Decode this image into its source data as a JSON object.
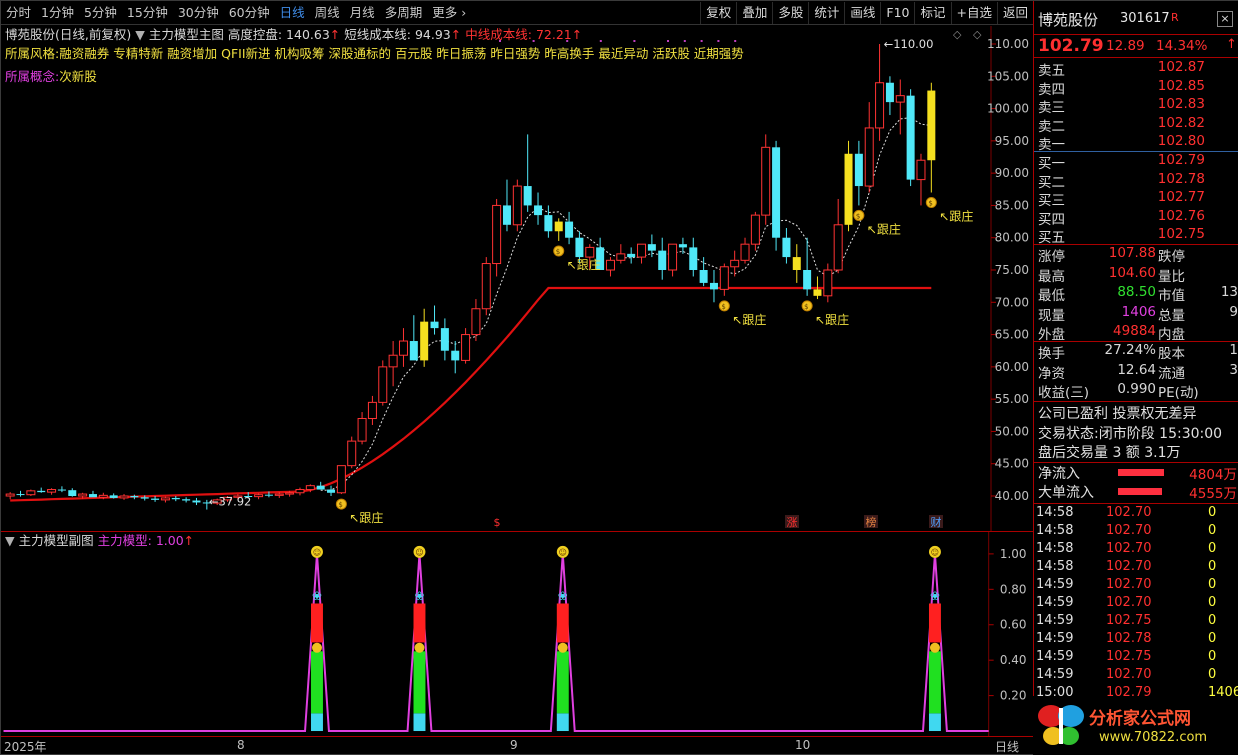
{
  "toolbar": {
    "periods": [
      "分时",
      "1分钟",
      "5分钟",
      "15分钟",
      "30分钟",
      "60分钟",
      "日线",
      "周线",
      "月线",
      "多周期",
      "更多"
    ],
    "active_period": "日线",
    "buttons": [
      "复权",
      "叠加",
      "多股",
      "统计",
      "画线",
      "F10",
      "标记",
      "+自选",
      "返回"
    ]
  },
  "header": {
    "stock_name": "博苑股份",
    "mode": "(日线,前复权)",
    "indicator": "主力模型主图",
    "height_label": "高度控盘:",
    "height_value": "140.63",
    "short_label": "短线成本线:",
    "short_value": "94.93",
    "mid_label": "中线成本线:",
    "mid_value": "72.21"
  },
  "tags": {
    "style_label": "所属风格:",
    "style_value": "融资融券 专精特新 融资增加 QFII新进 机构吸筹 深股通标的 百元股 昨日振荡 昨日强势 昨高换手 最近异动 活跃股 近期强势",
    "concept_label": "所属概念:",
    "concept_value": "次新股"
  },
  "chart_data": {
    "type": "candlestick",
    "y_ticks": [
      "110.00",
      "105.00",
      "100.00",
      "95.00",
      "90.00",
      "85.00",
      "80.00",
      "75.00",
      "70.00",
      "65.00",
      "60.00",
      "55.00",
      "50.00",
      "45.00",
      "40.00"
    ],
    "ylim": [
      37,
      112
    ],
    "candles": [
      [
        40.0,
        40.6,
        39.5,
        40.3
      ],
      [
        40.3,
        40.8,
        39.9,
        40.2
      ],
      [
        40.2,
        41.0,
        40.0,
        40.8
      ],
      [
        40.8,
        41.3,
        40.5,
        40.6
      ],
      [
        40.6,
        41.2,
        40.2,
        41.0
      ],
      [
        41.0,
        41.5,
        40.6,
        40.9
      ],
      [
        40.9,
        41.2,
        39.9,
        40.0
      ],
      [
        40.0,
        40.5,
        39.6,
        40.3
      ],
      [
        40.3,
        40.8,
        39.9,
        39.8
      ],
      [
        39.8,
        40.5,
        39.5,
        40.1
      ],
      [
        40.1,
        40.4,
        39.6,
        39.7
      ],
      [
        39.7,
        40.3,
        39.4,
        40.0
      ],
      [
        40.0,
        40.2,
        39.5,
        39.8
      ],
      [
        39.8,
        40.1,
        39.3,
        39.6
      ],
      [
        39.6,
        40.0,
        39.1,
        39.4
      ],
      [
        39.4,
        39.9,
        39.0,
        39.7
      ],
      [
        39.7,
        40.0,
        39.2,
        39.5
      ],
      [
        39.5,
        39.8,
        39.0,
        39.3
      ],
      [
        39.3,
        39.7,
        38.6,
        39.0
      ],
      [
        39.0,
        39.4,
        37.9,
        38.9
      ],
      [
        38.9,
        39.6,
        38.6,
        39.4
      ],
      [
        39.4,
        40.0,
        39.1,
        39.8
      ],
      [
        39.8,
        40.3,
        39.4,
        40.0
      ],
      [
        40.0,
        40.6,
        39.6,
        39.9
      ],
      [
        39.9,
        40.4,
        39.5,
        40.2
      ],
      [
        40.2,
        40.7,
        39.8,
        40.1
      ],
      [
        40.1,
        40.6,
        39.7,
        40.3
      ],
      [
        40.3,
        40.8,
        39.9,
        40.5
      ],
      [
        40.5,
        41.3,
        40.1,
        41.0
      ],
      [
        41.0,
        41.8,
        40.6,
        41.6
      ],
      [
        41.6,
        42.2,
        41.0,
        41.0
      ],
      [
        41.0,
        41.6,
        40.0,
        40.5
      ],
      [
        40.5,
        44.7,
        40.3,
        44.7
      ],
      [
        44.7,
        49.2,
        44.3,
        48.5
      ],
      [
        48.5,
        53.0,
        48.0,
        52.0
      ],
      [
        52.0,
        55.5,
        51.0,
        54.5
      ],
      [
        54.5,
        61.0,
        54.0,
        60.0
      ],
      [
        60.0,
        64.0,
        57.0,
        61.8
      ],
      [
        61.8,
        66.0,
        60.0,
        64.0
      ],
      [
        64.0,
        68.0,
        62.0,
        61.0
      ],
      [
        61.0,
        69.0,
        60.0,
        67.0
      ],
      [
        67.0,
        69.5,
        65.0,
        66.0
      ],
      [
        66.0,
        67.5,
        61.0,
        62.5
      ],
      [
        62.5,
        64.0,
        59.0,
        61.0
      ],
      [
        61.0,
        66.0,
        60.5,
        65.0
      ],
      [
        65.0,
        70.5,
        64.0,
        69.0
      ],
      [
        69.0,
        77.0,
        68.0,
        76.0
      ],
      [
        76.0,
        86.0,
        74.0,
        85.0
      ],
      [
        85.0,
        89.0,
        81.0,
        82.0
      ],
      [
        82.0,
        89.0,
        81.0,
        88.0
      ],
      [
        88.0,
        96.0,
        84.0,
        85.0
      ],
      [
        85.0,
        87.0,
        82.0,
        83.5
      ],
      [
        83.5,
        85.0,
        80.0,
        81.0
      ],
      [
        81.0,
        83.0,
        79.5,
        82.5
      ],
      [
        82.5,
        84.0,
        79.0,
        80.0
      ],
      [
        80.0,
        81.0,
        76.0,
        77.0
      ],
      [
        77.0,
        79.0,
        75.0,
        78.5
      ],
      [
        78.5,
        80.0,
        75.0,
        75.0
      ],
      [
        75.0,
        77.0,
        74.0,
        76.5
      ],
      [
        76.5,
        79.0,
        76.0,
        77.5
      ],
      [
        77.5,
        78.5,
        76.0,
        77.0
      ],
      [
        77.0,
        78.5,
        76.0,
        79.0
      ],
      [
        79.0,
        80.5,
        77.0,
        78.0
      ],
      [
        78.0,
        80.0,
        73.5,
        75.0
      ],
      [
        75.0,
        76.0,
        74.0,
        79.0
      ],
      [
        79.0,
        80.0,
        77.5,
        78.5
      ],
      [
        78.5,
        80.0,
        74.0,
        75.0
      ],
      [
        75.0,
        77.0,
        72.5,
        73.0
      ],
      [
        73.0,
        75.0,
        70.0,
        72.0
      ],
      [
        72.0,
        76.0,
        71.0,
        75.5
      ],
      [
        75.5,
        78.0,
        74.0,
        76.5
      ],
      [
        76.5,
        80.0,
        76.0,
        79.0
      ],
      [
        79.0,
        84.0,
        78.0,
        83.5
      ],
      [
        83.5,
        96.0,
        82.0,
        94.0
      ],
      [
        94.0,
        95.0,
        78.0,
        80.0
      ],
      [
        80.0,
        81.5,
        76.0,
        77.0
      ],
      [
        77.0,
        79.0,
        73.0,
        75.0
      ],
      [
        75.0,
        80.0,
        71.0,
        72.0
      ],
      [
        72.0,
        74.0,
        70.5,
        71.0
      ],
      [
        71.0,
        76.0,
        70.0,
        75.0
      ],
      [
        75.0,
        86.0,
        74.5,
        82.0
      ],
      [
        82.0,
        95.0,
        81.0,
        93.0
      ],
      [
        93.0,
        95.0,
        85.0,
        88.0
      ],
      [
        88.0,
        101.0,
        87.0,
        97.0
      ],
      [
        97.0,
        110.0,
        95.0,
        104.0
      ],
      [
        104.0,
        105.0,
        99.0,
        101.0
      ],
      [
        101.0,
        104.5,
        96.0,
        102.0
      ],
      [
        102.0,
        103.0,
        88.0,
        89.0
      ],
      [
        89.0,
        93.0,
        85.0,
        92.0
      ],
      [
        92.0,
        104.0,
        87.0,
        102.79
      ]
    ],
    "markers": {
      "high_label": "110.00",
      "low_label": "37.92",
      "follow_label": "跟庄",
      "event_tags": [
        "$",
        "涨",
        "榜",
        "财"
      ]
    }
  },
  "sub": {
    "title": "主力模型副图",
    "label": "主力模型:",
    "value": "1.00",
    "y_ticks": [
      "1.00",
      "0.80",
      "0.60",
      "0.40",
      "0.20"
    ]
  },
  "xaxis": {
    "labels": [
      "2025年",
      "8",
      "9",
      "10"
    ],
    "right_label": "日线"
  },
  "quote": {
    "name": "博苑股份",
    "code": "301617",
    "flag": "R",
    "price": "102.79",
    "change": "12.89",
    "pct": "14.34%",
    "asks": [
      {
        "label": "卖五",
        "price": "102.87"
      },
      {
        "label": "卖四",
        "price": "102.85"
      },
      {
        "label": "卖三",
        "price": "102.83"
      },
      {
        "label": "卖二",
        "price": "102.82"
      },
      {
        "label": "卖一",
        "price": "102.80"
      }
    ],
    "bids": [
      {
        "label": "买一",
        "price": "102.79"
      },
      {
        "label": "买二",
        "price": "102.78"
      },
      {
        "label": "买三",
        "price": "102.77"
      },
      {
        "label": "买四",
        "price": "102.76"
      },
      {
        "label": "买五",
        "price": "102.75"
      }
    ],
    "stats": [
      {
        "l1": "涨停",
        "v1": "107.88",
        "c1": "#ff3030",
        "l2": "跌停",
        "v2": ""
      },
      {
        "l1": "最高",
        "v1": "104.60",
        "c1": "#ff3030",
        "l2": "量比",
        "v2": ""
      },
      {
        "l1": "最低",
        "v1": "88.50",
        "c1": "#30e030",
        "l2": "市值",
        "v2": "13"
      },
      {
        "l1": "现量",
        "v1": "1406",
        "c1": "#e040e0",
        "l2": "总量",
        "v2": "9"
      },
      {
        "l1": "外盘",
        "v1": "49884",
        "c1": "#ff3030",
        "l2": "内盘",
        "v2": ""
      }
    ],
    "stats2": [
      {
        "l1": "换手",
        "v1": "27.24%",
        "c1": "#d8d8d8",
        "l2": "股本",
        "v2": "1"
      },
      {
        "l1": "净资",
        "v1": "12.64",
        "c1": "#d8d8d8",
        "l2": "流通",
        "v2": "3"
      },
      {
        "l1": "收益(三)",
        "v1": "0.990",
        "c1": "#d8d8d8",
        "l2": "PE(动)",
        "v2": ""
      }
    ],
    "profit_text": "公司已盈利 投票权无差异",
    "trade_status_label": "交易状态:",
    "trade_status_value": "闭市阶段",
    "trade_status_time": "15:30:00",
    "after_hours": "盘后交易量 3 额 3.1万",
    "net_inflow_label": "净流入",
    "net_inflow_value": "4804万",
    "big_inflow_label": "大单流入",
    "big_inflow_value": "4555万",
    "ticks": [
      {
        "t": "14:58",
        "p": "102.70",
        "v": "0"
      },
      {
        "t": "14:58",
        "p": "102.70",
        "v": "0"
      },
      {
        "t": "14:58",
        "p": "102.70",
        "v": "0"
      },
      {
        "t": "14:58",
        "p": "102.70",
        "v": "0"
      },
      {
        "t": "14:59",
        "p": "102.70",
        "v": "0"
      },
      {
        "t": "14:59",
        "p": "102.70",
        "v": "0"
      },
      {
        "t": "14:59",
        "p": "102.75",
        "v": "0"
      },
      {
        "t": "14:59",
        "p": "102.78",
        "v": "0"
      },
      {
        "t": "14:59",
        "p": "102.75",
        "v": "0"
      },
      {
        "t": "14:59",
        "p": "102.70",
        "v": "0"
      },
      {
        "t": "15:00",
        "p": "102.79",
        "v": "1406"
      }
    ]
  },
  "logo": {
    "text": "分析家公式网",
    "url": "www.70822.com"
  }
}
